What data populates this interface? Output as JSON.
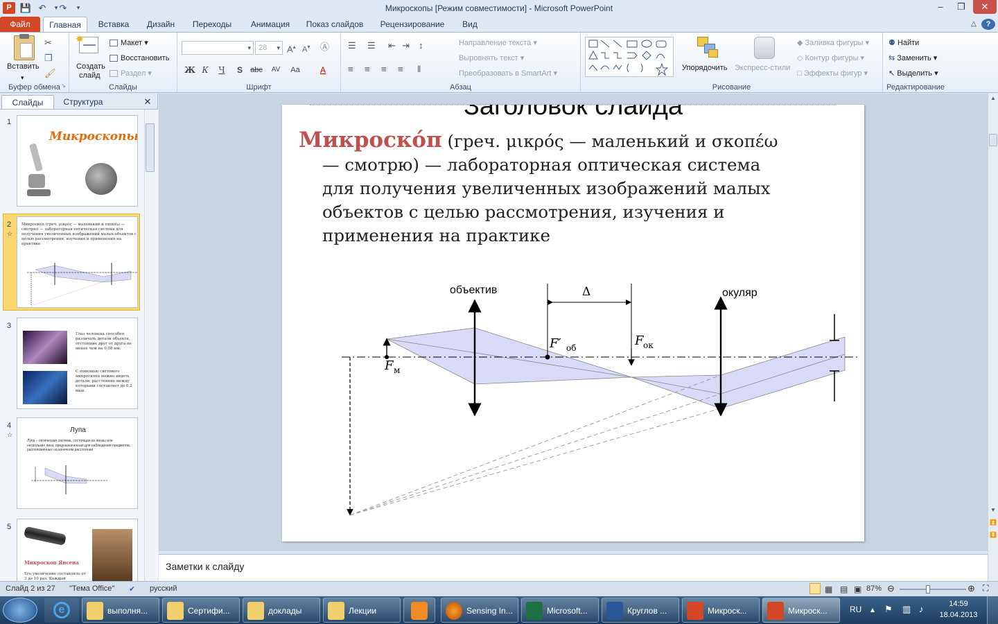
{
  "window": {
    "title": "Микроскопы [Режим совместимости]  -  Microsoft PowerPoint"
  },
  "tabs": [
    {
      "label": "Файл"
    },
    {
      "label": "Главная"
    },
    {
      "label": "Вставка"
    },
    {
      "label": "Дизайн"
    },
    {
      "label": "Переходы"
    },
    {
      "label": "Анимация"
    },
    {
      "label": "Показ слайдов"
    },
    {
      "label": "Рецензирование"
    },
    {
      "label": "Вид"
    }
  ],
  "ribbon": {
    "clipboard": {
      "paste": "Вставить",
      "label": "Буфер обмена"
    },
    "slides": {
      "new_slide_1": "Создать",
      "new_slide_2": "слайд",
      "layout": "Макет",
      "reset": "Восстановить",
      "section": "Раздел",
      "label": "Слайды"
    },
    "font": {
      "size": "28",
      "label": "Шрифт"
    },
    "paragraph": {
      "text_direction": "Направление текста",
      "align_text": "Выровнять текст",
      "smartart": "Преобразовать в SmartArt",
      "label": "Абзац"
    },
    "drawing": {
      "arrange": "Упорядочить",
      "quick_styles": "Экспресс-стили",
      "fill": "Заливка фигуры",
      "outline": "Контур фигуры",
      "effects": "Эффекты фигур",
      "label": "Рисование"
    },
    "editing": {
      "find": "Найти",
      "replace": "Заменить",
      "select": "Выделить",
      "label": "Редактирование"
    }
  },
  "panel": {
    "tab_slides": "Слайды",
    "tab_outline": "Структура",
    "thumbs": [
      {
        "num": "1",
        "title": "Микроскопы"
      },
      {
        "num": "2",
        "text": "Микроско́п (греч. μικρός — маленький и σκοπέω — смотрю) — лабораторная оптическая система для получения увеличенных изображений малых объектов с целью рассмотрения, изучения и применения на практике"
      },
      {
        "num": "3",
        "b1": "Глаз человека способен различать детали объекта, отстоящие друг от друга не менее чем на 0,08 мм.",
        "b2": "С помощью светового микроскопа можно видеть детали, расстояние между которыми составляет до 0,2 мкм."
      },
      {
        "num": "4",
        "title": "Лупа",
        "text": "Лупа – оптическая система, состоящая из линзы или нескольких линз, предназначенная для наблюдения предметов, расположенных на конечном расстоянии"
      },
      {
        "num": "5",
        "title": "Микроскоп Янсена",
        "text": "Его увеличение составляло от 3 до 10 раз. Каждый"
      }
    ]
  },
  "slide": {
    "title": "Заголовок слайда",
    "term": "Микроско́п",
    "body_1": " (греч. μικρός — маленький и σκοπέω",
    "body_2": "— смотрю) — лабораторная оптическая система",
    "body_3": "для получения увеличенных изображений малых",
    "body_4": "объектов с целью рассмотрения, изучения и",
    "body_5": "применения на практике",
    "diagram": {
      "objective": "объектив",
      "eyepiece": "окуляр",
      "delta": "Δ",
      "f_ob": "F′",
      "f_ob_sub": "об",
      "f_ok": "F",
      "f_ok_sub": "ок",
      "f_m": "F",
      "f_m_sub": "м"
    }
  },
  "notes": {
    "placeholder": "Заметки к слайду"
  },
  "status": {
    "slide": "Слайд 2 из 27",
    "theme": "\"Тема Office\"",
    "lang": "русский",
    "zoom": "87%"
  },
  "taskbar": {
    "items": [
      "выполня...",
      "Сертифи...",
      "доклады",
      "Лекции",
      "",
      "Sensing In...",
      "Microsoft...",
      "Круглов ...",
      "Микроск...",
      "Микроск..."
    ],
    "lang": "RU",
    "time": "14:59",
    "date": "18.04.2013"
  },
  "colors": {
    "accent": "#d24726",
    "term": "#c0504d",
    "lens_fill": "#d8daf8"
  }
}
